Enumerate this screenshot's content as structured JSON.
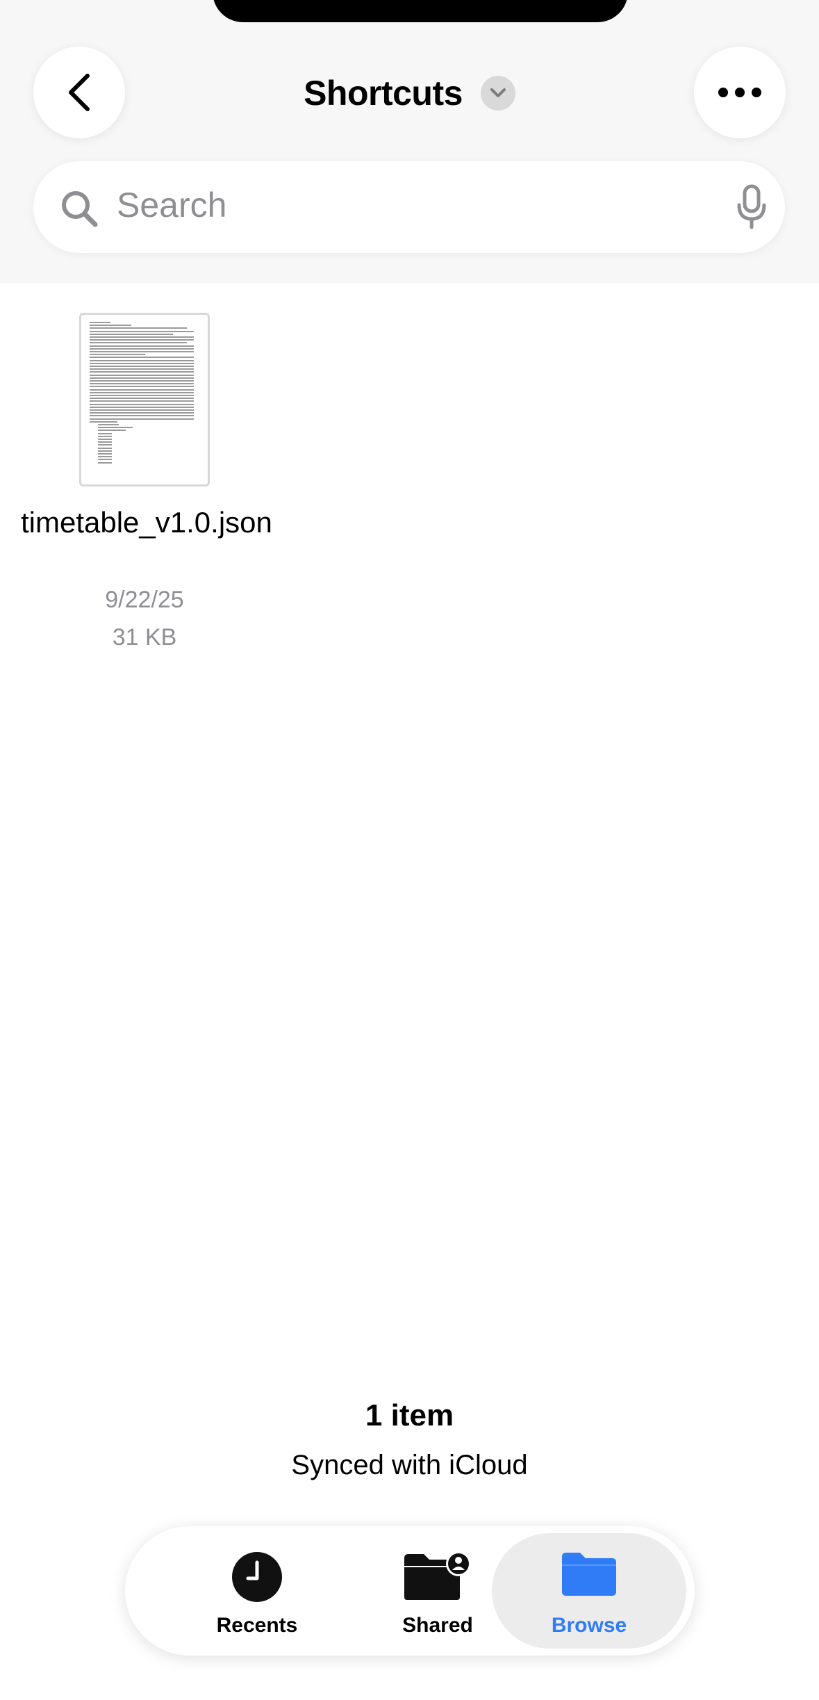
{
  "header": {
    "title": "Shortcuts"
  },
  "search": {
    "placeholder": "Search"
  },
  "files": [
    {
      "name": "timetable_v1.0.json",
      "date": "9/22/25",
      "size": "31 KB"
    }
  ],
  "footer": {
    "count": "1 item",
    "sync": "Synced with iCloud"
  },
  "tabs": [
    {
      "label": "Recents",
      "icon": "clock-icon",
      "active": false
    },
    {
      "label": "Shared",
      "icon": "shared-folder-icon",
      "active": false
    },
    {
      "label": "Browse",
      "icon": "folder-icon",
      "active": true
    }
  ],
  "colors": {
    "accent": "#2f7cf6",
    "secondary_text": "#8e8e93",
    "background_top": "#f7f7f7"
  }
}
